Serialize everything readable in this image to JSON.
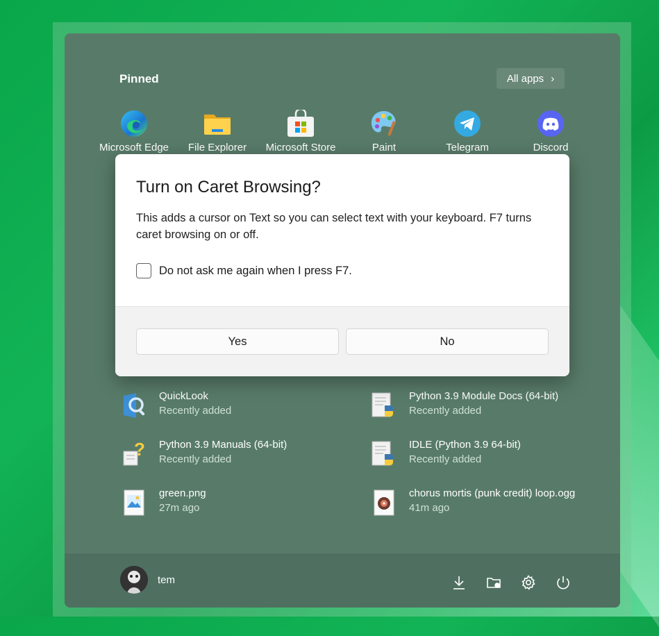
{
  "pinned": {
    "title": "Pinned",
    "all_apps_label": "All apps",
    "apps": [
      {
        "label": "Microsoft Edge",
        "icon": "edge-icon"
      },
      {
        "label": "File Explorer",
        "icon": "folder-icon"
      },
      {
        "label": "Microsoft Store",
        "icon": "store-icon"
      },
      {
        "label": "Paint",
        "icon": "paint-icon"
      },
      {
        "label": "Telegram",
        "icon": "telegram-icon"
      },
      {
        "label": "Discord",
        "icon": "discord-icon"
      }
    ]
  },
  "recommended": [
    {
      "title": "QuickLook",
      "subtitle": "Recently added",
      "icon": "quicklook-icon"
    },
    {
      "title": "Python 3.9 Module Docs (64-bit)",
      "subtitle": "Recently added",
      "icon": "python-doc-icon"
    },
    {
      "title": "Python 3.9 Manuals (64-bit)",
      "subtitle": "Recently added",
      "icon": "python-help-icon"
    },
    {
      "title": "IDLE (Python 3.9 64-bit)",
      "subtitle": "Recently added",
      "icon": "python-doc-icon"
    },
    {
      "title": "green.png",
      "subtitle": "27m ago",
      "icon": "image-file-icon"
    },
    {
      "title": "chorus mortis (punk credit) loop.ogg",
      "subtitle": "41m ago",
      "icon": "audio-file-icon"
    }
  ],
  "user": {
    "name": "tem"
  },
  "footer_icons": [
    "downloads-icon",
    "file-explorer-icon",
    "settings-icon",
    "power-icon"
  ],
  "dialog": {
    "title": "Turn on Caret Browsing?",
    "message": "This adds a cursor on Text so you can select text with your keyboard. F7 turns caret browsing on or off.",
    "checkbox_label": "Do not ask me again when I press F7.",
    "checkbox_checked": false,
    "yes_label": "Yes",
    "no_label": "No"
  },
  "colors": {
    "desktop_green": "#12b356",
    "start_bg": "#587b69",
    "dialog_bg": "#ffffff"
  }
}
